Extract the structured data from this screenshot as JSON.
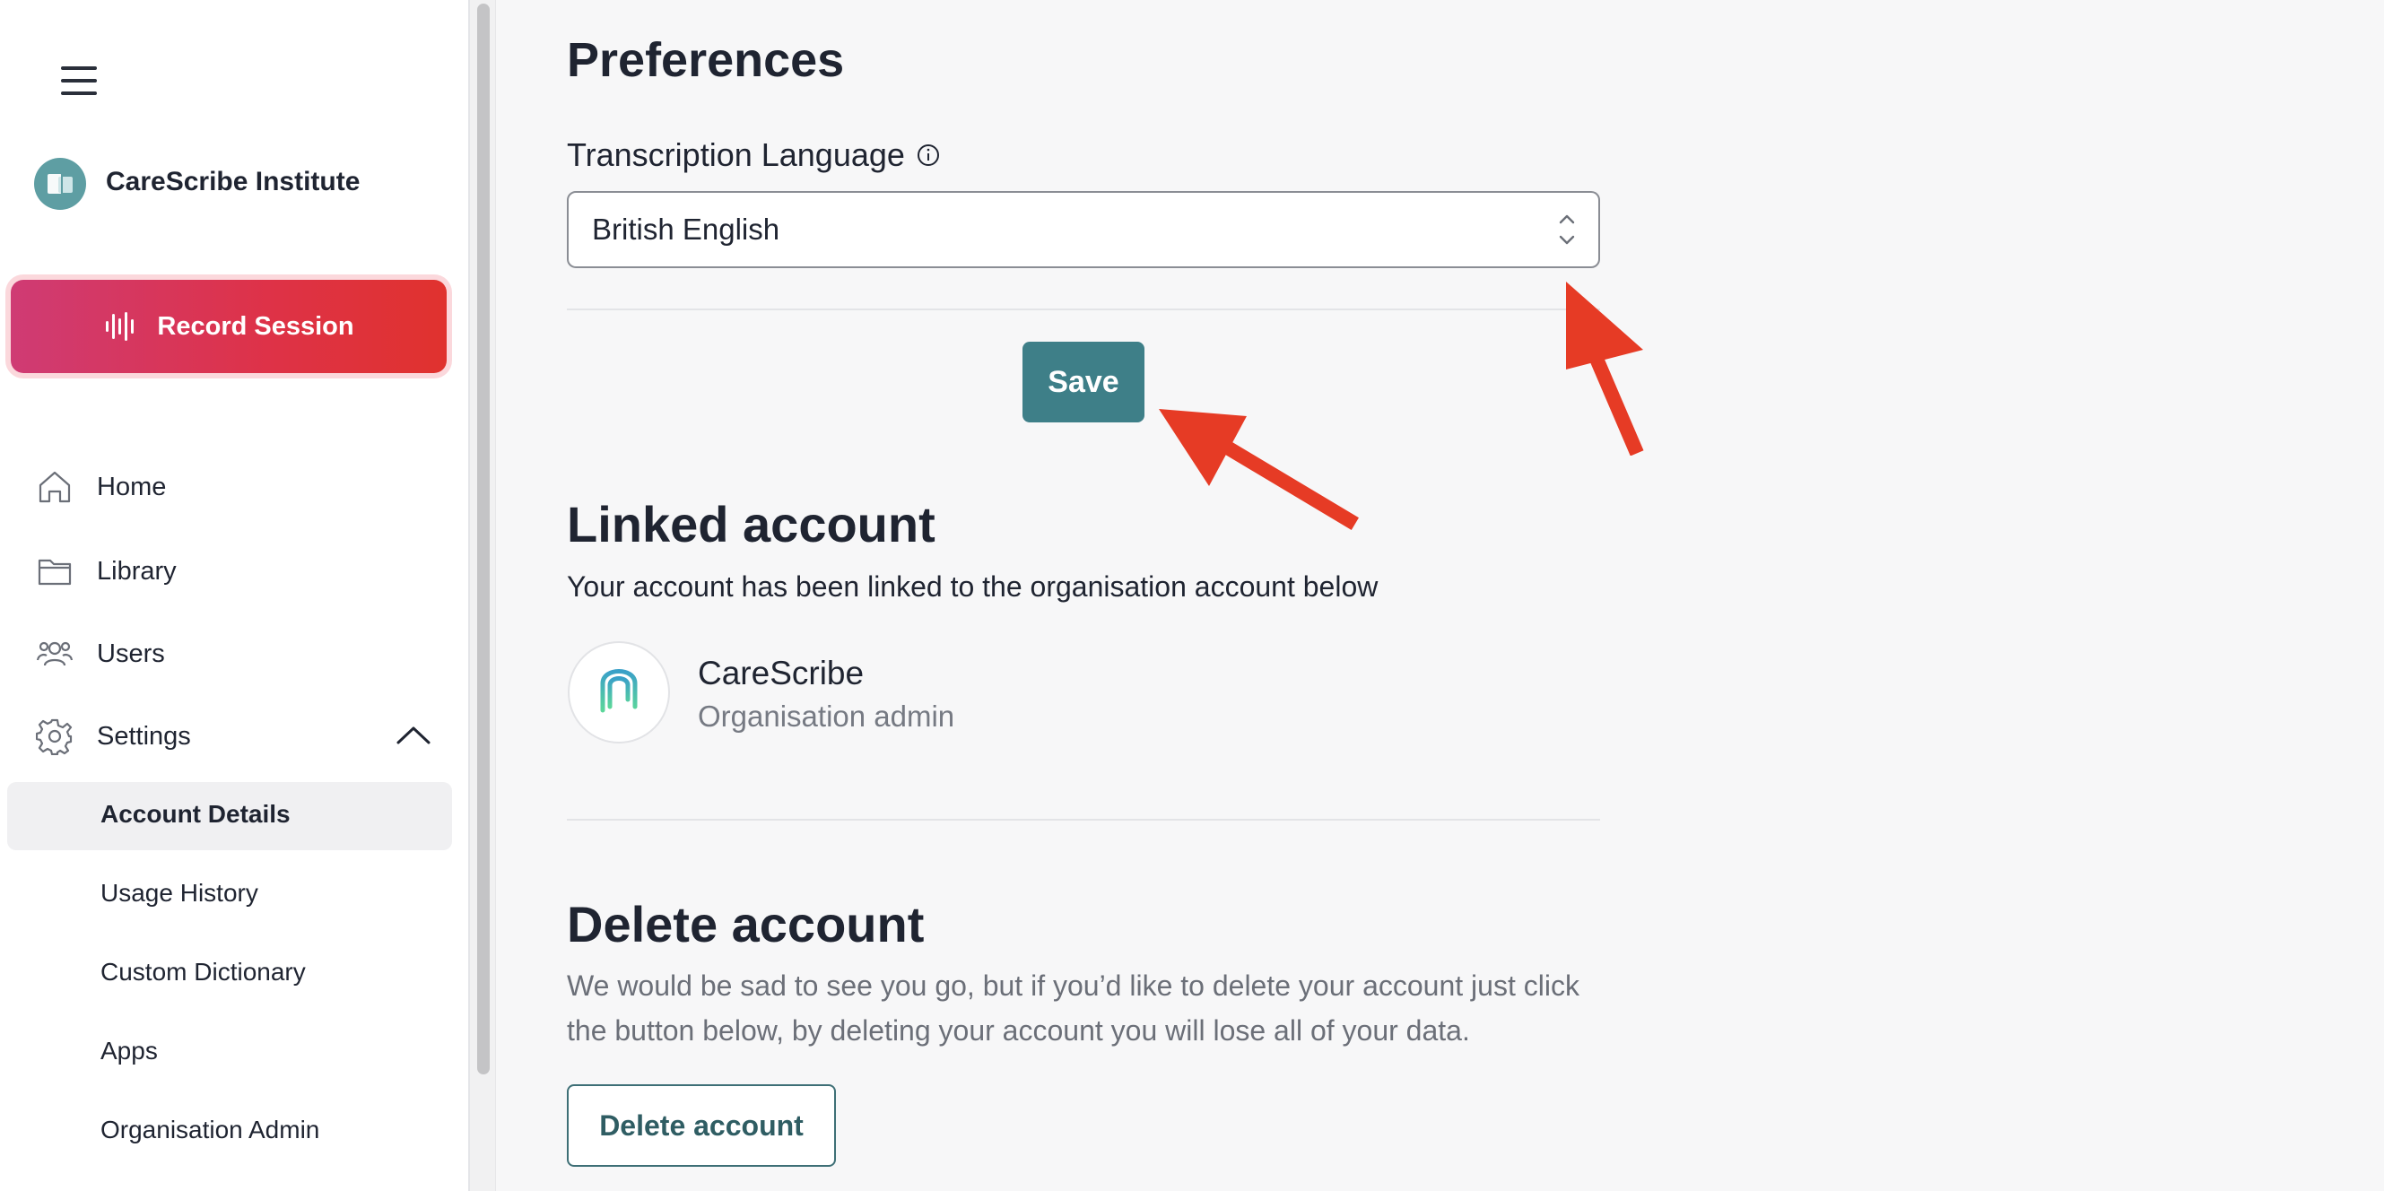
{
  "sidebar": {
    "org_name": "CareScribe Institute",
    "record_button_label": "Record Session",
    "nav": [
      {
        "label": "Home",
        "icon": "home-icon"
      },
      {
        "label": "Library",
        "icon": "folder-icon"
      },
      {
        "label": "Users",
        "icon": "users-icon"
      },
      {
        "label": "Settings",
        "icon": "gear-icon"
      }
    ],
    "settings_sub": [
      {
        "label": "Account Details",
        "active": true
      },
      {
        "label": "Usage History"
      },
      {
        "label": "Custom Dictionary"
      },
      {
        "label": "Apps"
      },
      {
        "label": "Organisation Admin"
      }
    ]
  },
  "preferences": {
    "title": "Preferences",
    "language_label": "Transcription Language",
    "language_value": "British English",
    "save_label": "Save"
  },
  "linked": {
    "title": "Linked account",
    "description": "Your account has been linked to the organisation account below",
    "org_name": "CareScribe",
    "org_role": "Organisation admin"
  },
  "delete": {
    "title": "Delete account",
    "description": "We would be sad to see you go, but if you’d like to delete your account just click the button below, by deleting your account you will lose all of your data.",
    "button_label": "Delete account"
  },
  "colors": {
    "accent": "#3e7f88",
    "record_gradient_start": "#cf3b74",
    "record_gradient_end": "#e0322e",
    "annotation_arrow": "#e63b25"
  }
}
